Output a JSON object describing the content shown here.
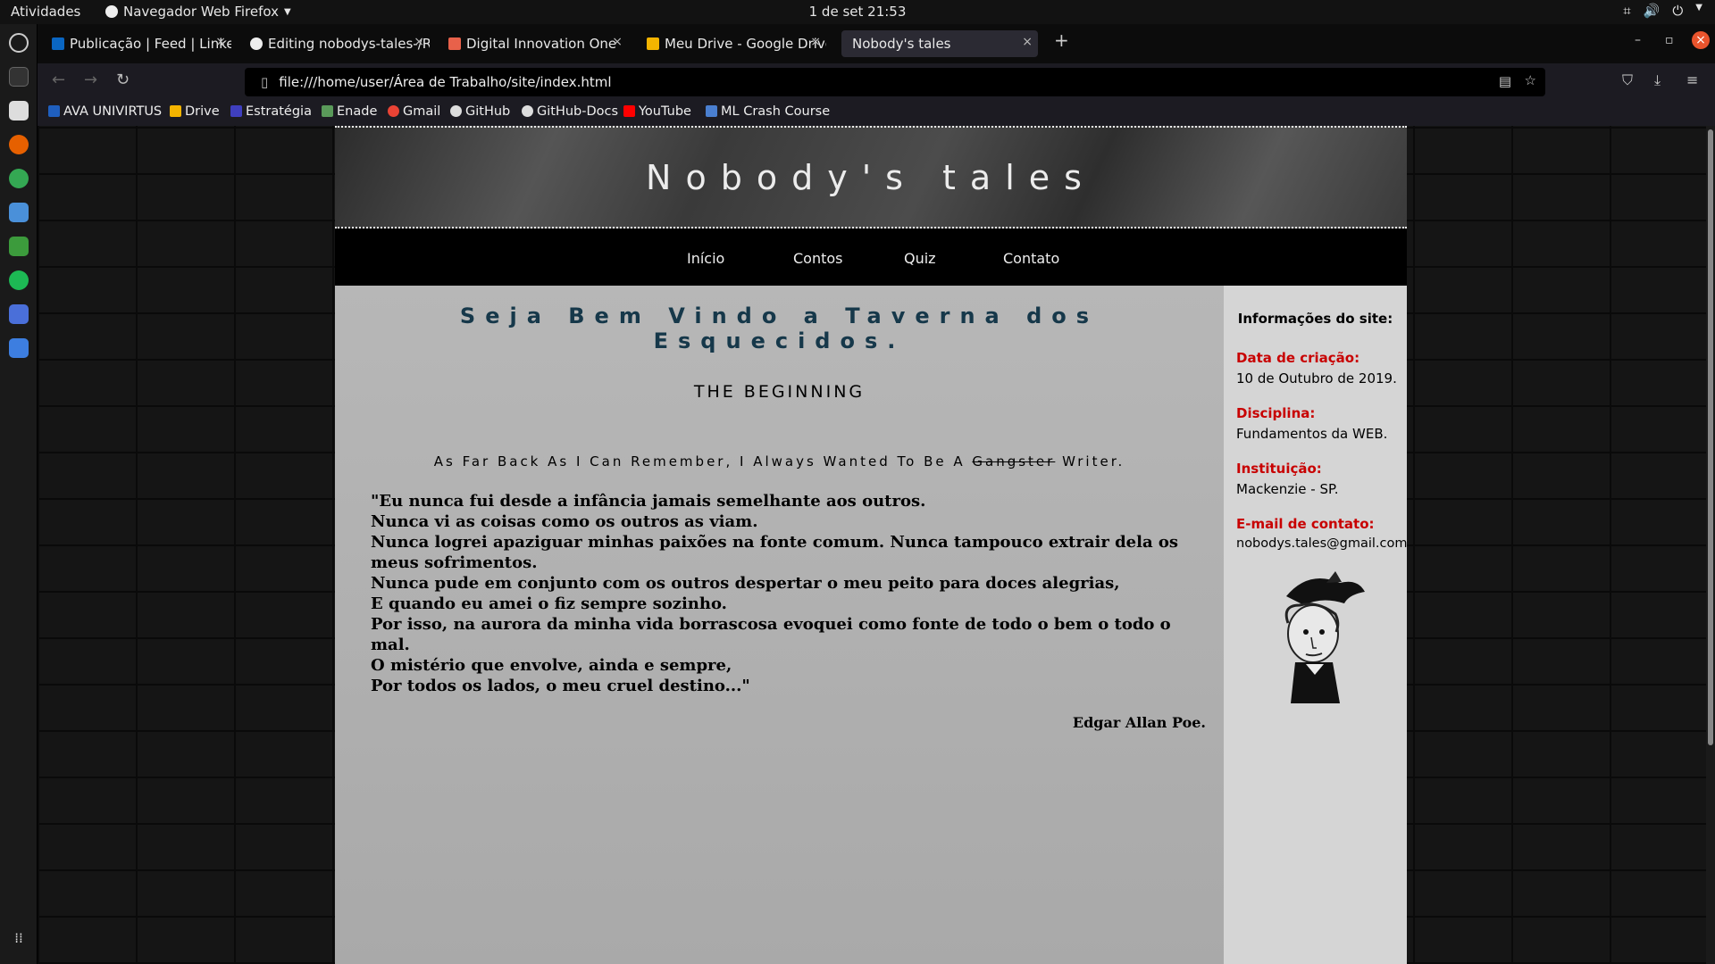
{
  "os": {
    "activities": "Atividades",
    "app_name": "Navegador Web Firefox",
    "datetime": "1 de set  21:53"
  },
  "tabs": [
    {
      "title": "Publicação | Feed | Linke",
      "favicon_color": "#0a66c2"
    },
    {
      "title": "Editing nobodys-tales-/R",
      "favicon_color": "#eeeeee"
    },
    {
      "title": "Digital Innovation One",
      "favicon_color": "#e8614a"
    },
    {
      "title": "Meu Drive - Google Drive",
      "favicon_color": "#f4b400"
    },
    {
      "title": "Nobody's tales",
      "favicon_color": "#2b2a33"
    }
  ],
  "url": "file:///home/user/Área de Trabalho/site/index.html",
  "bookmarks": [
    {
      "label": "AVA UNIVIRTUS",
      "color": "#1f5fbf"
    },
    {
      "label": "Drive",
      "color": "#f4b400"
    },
    {
      "label": "Estratégia",
      "color": "#3f3fbf"
    },
    {
      "label": "Enade",
      "color": "#5a9a5a"
    },
    {
      "label": "Gmail",
      "color": "#ea4335"
    },
    {
      "label": "GitHub",
      "color": "#dddddd"
    },
    {
      "label": "GitHub-Docs",
      "color": "#dddddd"
    },
    {
      "label": "YouTube",
      "color": "#ff0000"
    },
    {
      "label": "ML Crash Course",
      "color": "#4a7fd0"
    }
  ],
  "site": {
    "title": "Nobody's tales",
    "menu": [
      "Início",
      "Contos",
      "Quiz",
      "Contato"
    ],
    "welcome": "Seja Bem Vindo a Taverna dos Esquecidos.",
    "heading": "THE BEGINNING",
    "tagline_a": "As Far Back As I Can Remember, I Always Wanted To Be A ",
    "tagline_struck": "Gangster",
    "tagline_b": " Writer.",
    "poem": [
      "\"Eu nunca fui desde a infância jamais semelhante aos outros.",
      "Nunca vi as coisas como os outros as viam.",
      "Nunca logrei apaziguar minhas paixões na fonte comum. Nunca tampouco extrair dela os meus sofrimentos.",
      "Nunca pude em conjunto com os outros despertar o meu peito para doces alegrias,",
      "E quando eu amei o fiz sempre sozinho.",
      "Por isso, na aurora da minha vida borrascosa evoquei como fonte de todo o bem o todo o mal.",
      "O mistério que envolve, ainda e sempre,",
      "Por todos os lados, o meu cruel destino...\""
    ],
    "author": "Edgar Allan Poe.",
    "sidebar": {
      "title": "Informações do site:",
      "items": [
        {
          "label": "Data de criação:",
          "value": "10 de Outubro de 2019."
        },
        {
          "label": "Disciplina:",
          "value": "Fundamentos da WEB."
        },
        {
          "label": "Instituição:",
          "value": "Mackenzie - SP."
        },
        {
          "label": "E-mail de contato:",
          "value": "nobodys.tales@gmail.com"
        }
      ]
    }
  }
}
